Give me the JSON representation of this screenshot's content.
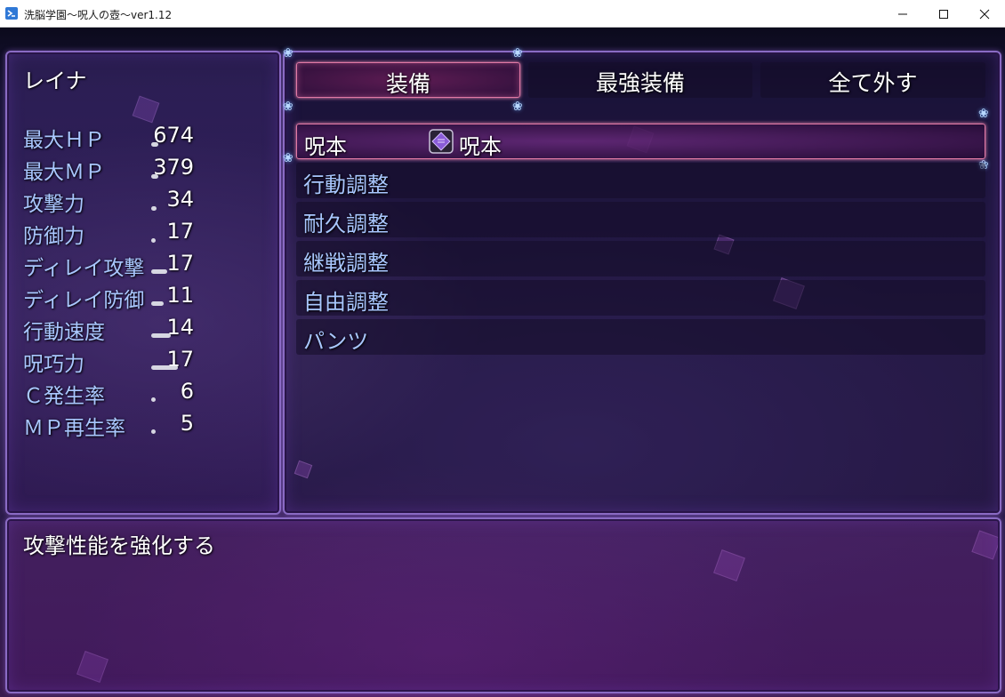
{
  "window": {
    "title": "洗脳学園～呪人の壺～ver1.12",
    "controls": [
      "minimize-icon",
      "maximize-icon",
      "close-icon"
    ]
  },
  "actor": {
    "name": "レイナ",
    "stats": [
      {
        "label": "最大ＨＰ",
        "value": "674"
      },
      {
        "label": "最大ＭＰ",
        "value": "379"
      },
      {
        "label": "攻撃力",
        "value": "34"
      },
      {
        "label": "防御力",
        "value": "17"
      },
      {
        "label": "ディレイ攻撃",
        "value": "17"
      },
      {
        "label": "ディレイ防御",
        "value": "11"
      },
      {
        "label": "行動速度",
        "value": "14"
      },
      {
        "label": "呪巧力",
        "value": "17"
      },
      {
        "label": "Ｃ発生率",
        "value": "6"
      },
      {
        "label": "ＭＰ再生率",
        "value": "5"
      }
    ]
  },
  "commands": [
    {
      "label": "装備",
      "selected": true
    },
    {
      "label": "最強装備",
      "selected": false
    },
    {
      "label": "全て外す",
      "selected": false
    }
  ],
  "slots": [
    {
      "label": "呪本",
      "item": "呪本",
      "item_icon": "spellbook-icon"
    },
    {
      "label": "行動調整",
      "item": ""
    },
    {
      "label": "耐久調整",
      "item": ""
    },
    {
      "label": "継戦調整",
      "item": ""
    },
    {
      "label": "自由調整",
      "item": ""
    },
    {
      "label": "パンツ",
      "item": ""
    }
  ],
  "help": {
    "text": "攻撃性能を強化する"
  },
  "colors": {
    "label_blue": "#a9c7ff",
    "value_white": "#ffffff",
    "panel_border": "#8a6bc4",
    "cursor_pink": "#e27aa5"
  }
}
